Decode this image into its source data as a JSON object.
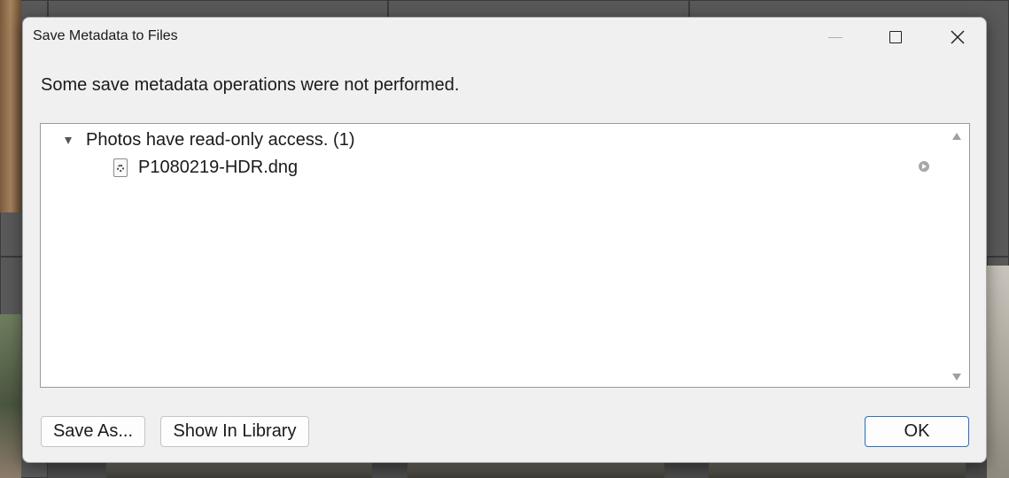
{
  "dialog": {
    "title": "Save Metadata to Files",
    "message": "Some save metadata operations were not performed.",
    "group_label": "Photos have read-only access. (1)",
    "file_name": "P1080219-HDR.dng"
  },
  "buttons": {
    "save_as": "Save As...",
    "show_in_library": "Show In Library",
    "ok": "OK"
  },
  "icons": {
    "minimize": "minimize-icon",
    "maximize": "maximize-icon",
    "close": "close-icon",
    "file": "dng-file-icon",
    "goto": "go-to-arrow-icon",
    "expand": "disclosure-triangle-icon"
  },
  "colors": {
    "dialog_bg": "#f0f0f0",
    "accent_border": "#2b6fc4"
  }
}
